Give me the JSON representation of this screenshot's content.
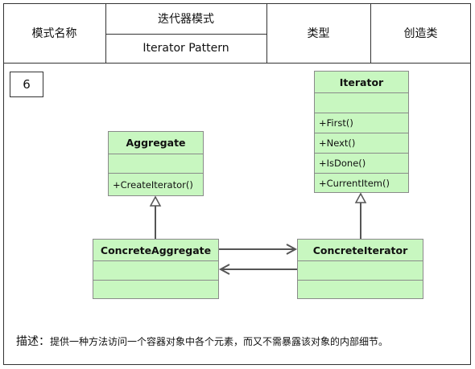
{
  "header": {
    "name_label": "模式名称",
    "pattern_cn": "迭代器模式",
    "pattern_en": "Iterator Pattern",
    "type_label": "类型",
    "type_value": "创造类"
  },
  "diagram_number": "6",
  "classes": {
    "aggregate": {
      "name": "Aggregate",
      "methods": [
        "+CreateIterator()"
      ]
    },
    "iterator": {
      "name": "Iterator",
      "methods": [
        "+First()",
        "+Next()",
        "+IsDone()",
        "+CurrentItem()"
      ]
    },
    "concrete_aggregate": {
      "name": "ConcreteAggregate"
    },
    "concrete_iterator": {
      "name": "ConcreteIterator"
    }
  },
  "description": {
    "label": "描述：",
    "text": "提供一种方法访问一个容器对象中各个元素，而又不需暴露该对象的内部细节。"
  },
  "colors": {
    "class_fill": "#c8f7c0",
    "border": "#333333",
    "arrow": "#555555"
  }
}
